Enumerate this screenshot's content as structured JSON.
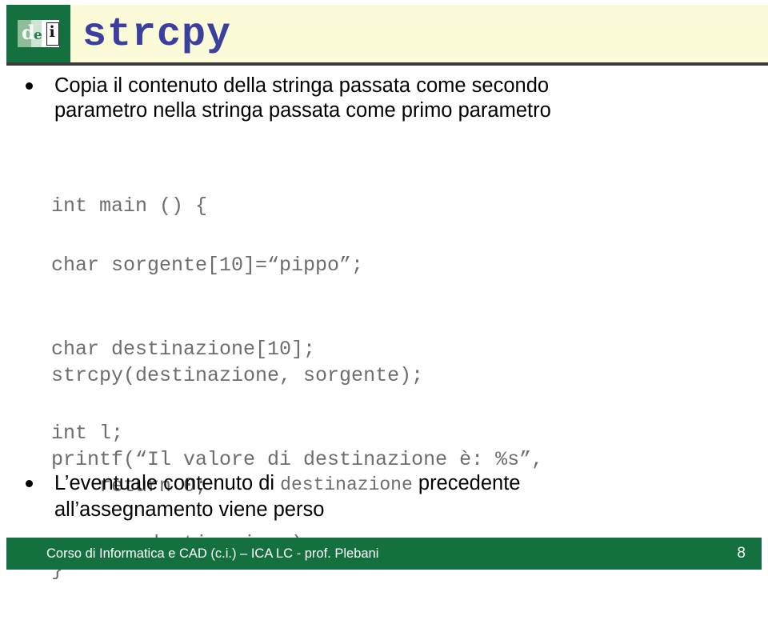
{
  "slide": {
    "title": "strcpy",
    "page_number": "8",
    "colors": {
      "header_bg": "#fcfbd7",
      "brand_green": "#14713f",
      "title_blue": "#3b3fa0",
      "code_gray": "#6d6d6d",
      "rule_dark": "#3b3b3b"
    }
  },
  "logo": {
    "letter_d": "d",
    "letter_e": "e",
    "letter_i": "i"
  },
  "bullets": [
    {
      "line1": "Copia il contenuto della stringa passata come secondo",
      "line2": "parametro nella stringa passata come primo parametro"
    }
  ],
  "bullet_last": {
    "part1": "L’eventuale contenuto di ",
    "mono": "destinazione",
    "part2": " precedente",
    "line2": "all’assegnamento viene perso"
  },
  "code": {
    "block1": "int main () {",
    "block2_line1": "char sorgente[10]=“pippo”;",
    "block2_line2": "char destinazione[10];",
    "block2_line3": "int l;",
    "block3_line1": "strcpy(destinazione, sorgente);",
    "block3_line2": "printf(“Il valore di destinazione è: %s”,",
    "block3_line3": "        destinazione);",
    "block4_line1": "    return 0;",
    "block4_line2": "}"
  },
  "footer": {
    "text": "Corso di Informatica e CAD (c.i.) – ICA LC - prof. Plebani",
    "page": "8"
  }
}
